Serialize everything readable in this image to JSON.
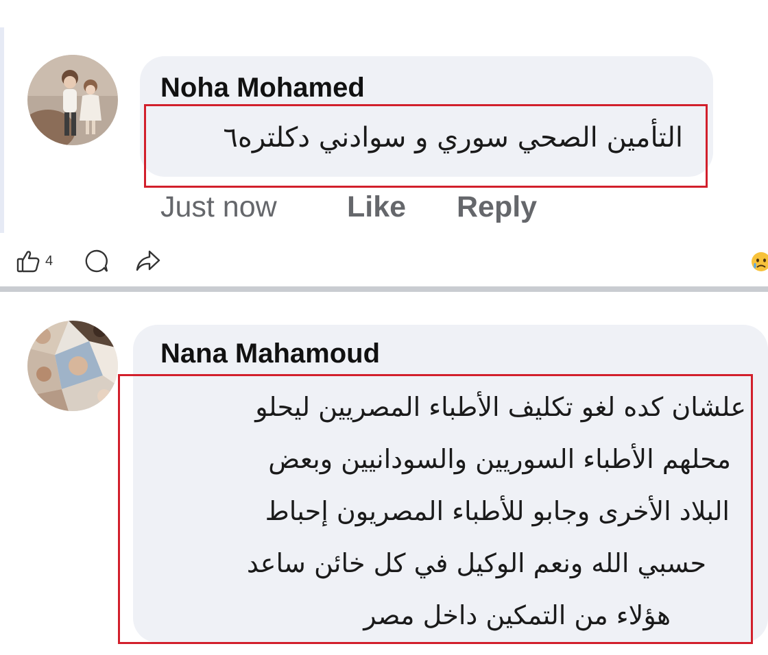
{
  "comments": [
    {
      "author": "Noha Mohamed",
      "lines": [
        "التأمين الصحي سوري و سوادني دكلتره٦"
      ],
      "timestamp": "Just now",
      "like_label": "Like",
      "reply_label": "Reply"
    },
    {
      "author": "Nana Mahamoud",
      "lines": [
        "علشان كده لغو تكليف الأطباء المصريين ليحلو",
        "محلهم الأطباء السوريين والسودانيين وبعض",
        "البلاد الأخرى وجابو للأطباء المصريون إحباط",
        "حسبي الله ونعم الوكيل في كل خائن ساعد",
        "هؤلاء من التمكين داخل مصر"
      ]
    }
  ],
  "post_actions": {
    "like_count": "4",
    "icons": [
      "thumbs-up-icon",
      "comment-icon",
      "share-icon",
      "sad-emoji-icon"
    ]
  },
  "colors": {
    "bubble": "#eff1f6",
    "highlight": "#d21f2b",
    "meta_text": "#65676b",
    "divider": "#c9ccd1"
  }
}
